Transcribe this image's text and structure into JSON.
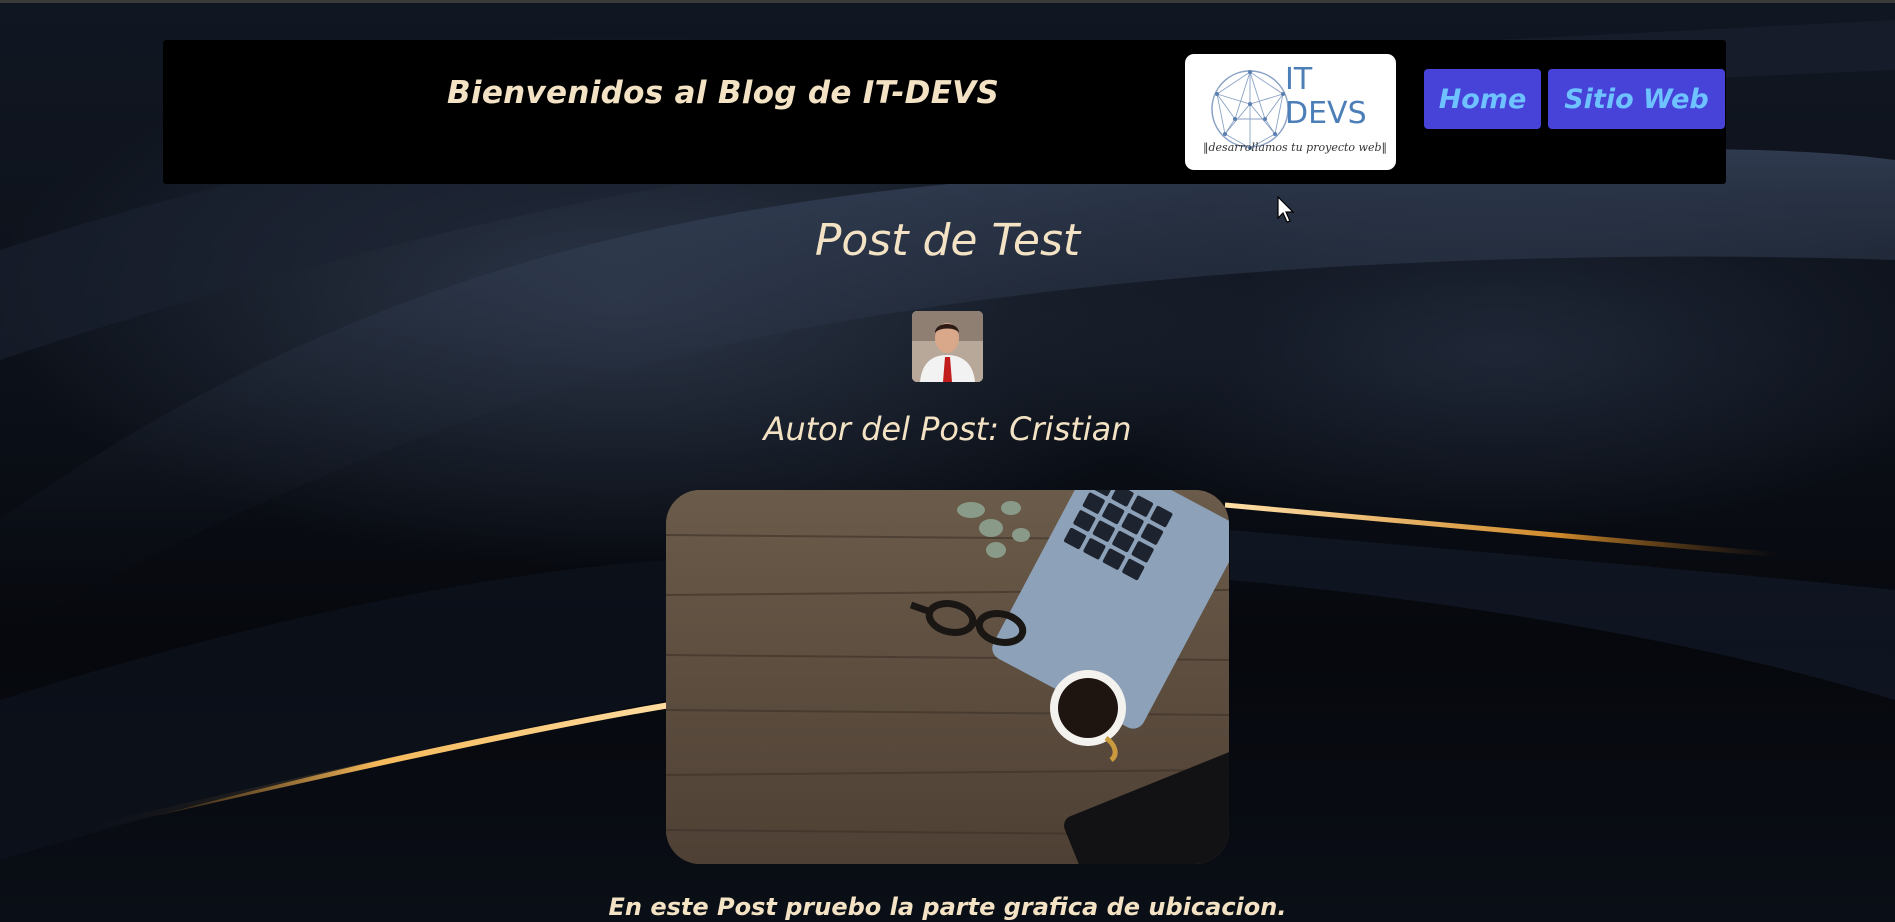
{
  "header": {
    "site_title": "Bienvenidos al Blog de IT-DEVS",
    "logo": {
      "line1": "IT",
      "line2": "DEVS",
      "tagline": "desarrollamos tu proyecto web"
    },
    "nav": {
      "home_label": "Home",
      "web_label": "Sitio Web"
    }
  },
  "post": {
    "title": "Post de Test",
    "author_line": "Autor del Post: Cristian",
    "body_text": "En este Post pruebo la parte grafica de ubicacion."
  },
  "colors": {
    "text_cream": "#f3e2c4",
    "button_bg": "#4743d8",
    "button_text": "#6ec2ff",
    "header_bg": "#000000",
    "logo_blue": "#4c7fb8"
  },
  "icons": {
    "cursor": "arrow-cursor-icon",
    "logo_globe": "network-globe-icon"
  }
}
